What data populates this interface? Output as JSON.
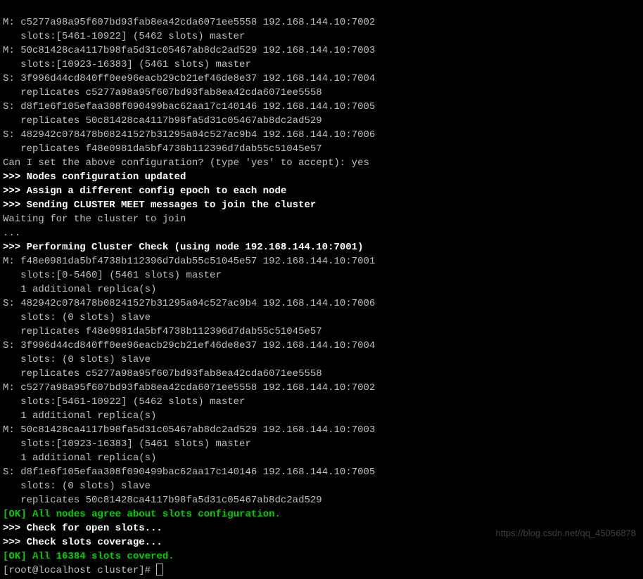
{
  "ip": "192.168.144.10",
  "nodes_initial": [
    {
      "role": "M",
      "id": "c5277a98a95f607bd93fab8ea42cda6071ee5558",
      "port": "7002",
      "detail": "   slots:[5461-10922] (5462 slots) master"
    },
    {
      "role": "M",
      "id": "50c81428ca4117b98fa5d31c05467ab8dc2ad529",
      "port": "7003",
      "detail": "   slots:[10923-16383] (5461 slots) master"
    },
    {
      "role": "S",
      "id": "3f996d44cd840ff0ee96eacb29cb21ef46de8e37",
      "port": "7004",
      "detail": "   replicates c5277a98a95f607bd93fab8ea42cda6071ee5558"
    },
    {
      "role": "S",
      "id": "d8f1e6f105efaa308f090499bac62aa17c140146",
      "port": "7005",
      "detail": "   replicates 50c81428ca4117b98fa5d31c05467ab8dc2ad529"
    },
    {
      "role": "S",
      "id": "482942c078478b08241527b31295a04c527ac9b4",
      "port": "7006",
      "detail": "   replicates f48e0981da5bf4738b112396d7dab55c51045e57"
    }
  ],
  "prompt_accept": "Can I set the above configuration? (type 'yes' to accept): yes",
  "steps": {
    "s1": ">>> Nodes configuration updated",
    "s2": ">>> Assign a different config epoch to each node",
    "s3": ">>> Sending CLUSTER MEET messages to join the cluster"
  },
  "waiting": "Waiting for the cluster to join",
  "dots": "...",
  "check_header": ">>> Performing Cluster Check (using node 192.168.144.10:7001)",
  "nodes_check": [
    {
      "role": "M",
      "id": "f48e0981da5bf4738b112396d7dab55c51045e57",
      "port": "7001",
      "d1": "   slots:[0-5460] (5461 slots) master",
      "d2": "   1 additional replica(s)"
    },
    {
      "role": "S",
      "id": "482942c078478b08241527b31295a04c527ac9b4",
      "port": "7006",
      "d1": "   slots: (0 slots) slave",
      "d2": "   replicates f48e0981da5bf4738b112396d7dab55c51045e57"
    },
    {
      "role": "S",
      "id": "3f996d44cd840ff0ee96eacb29cb21ef46de8e37",
      "port": "7004",
      "d1": "   slots: (0 slots) slave",
      "d2": "   replicates c5277a98a95f607bd93fab8ea42cda6071ee5558"
    },
    {
      "role": "M",
      "id": "c5277a98a95f607bd93fab8ea42cda6071ee5558",
      "port": "7002",
      "d1": "   slots:[5461-10922] (5462 slots) master",
      "d2": "   1 additional replica(s)"
    },
    {
      "role": "M",
      "id": "50c81428ca4117b98fa5d31c05467ab8dc2ad529",
      "port": "7003",
      "d1": "   slots:[10923-16383] (5461 slots) master",
      "d2": "   1 additional replica(s)"
    },
    {
      "role": "S",
      "id": "d8f1e6f105efaa308f090499bac62aa17c140146",
      "port": "7005",
      "d1": "   slots: (0 slots) slave",
      "d2": "   replicates 50c81428ca4117b98fa5d31c05467ab8dc2ad529"
    }
  ],
  "ok1": "[OK] All nodes agree about slots configuration.",
  "ck1": ">>> Check for open slots...",
  "ck2": ">>> Check slots coverage...",
  "ok2": "[OK] All 16384 slots covered.",
  "prompt": "[root@localhost cluster]# ",
  "watermark": "https://blog.csdn.net/qq_45056878"
}
